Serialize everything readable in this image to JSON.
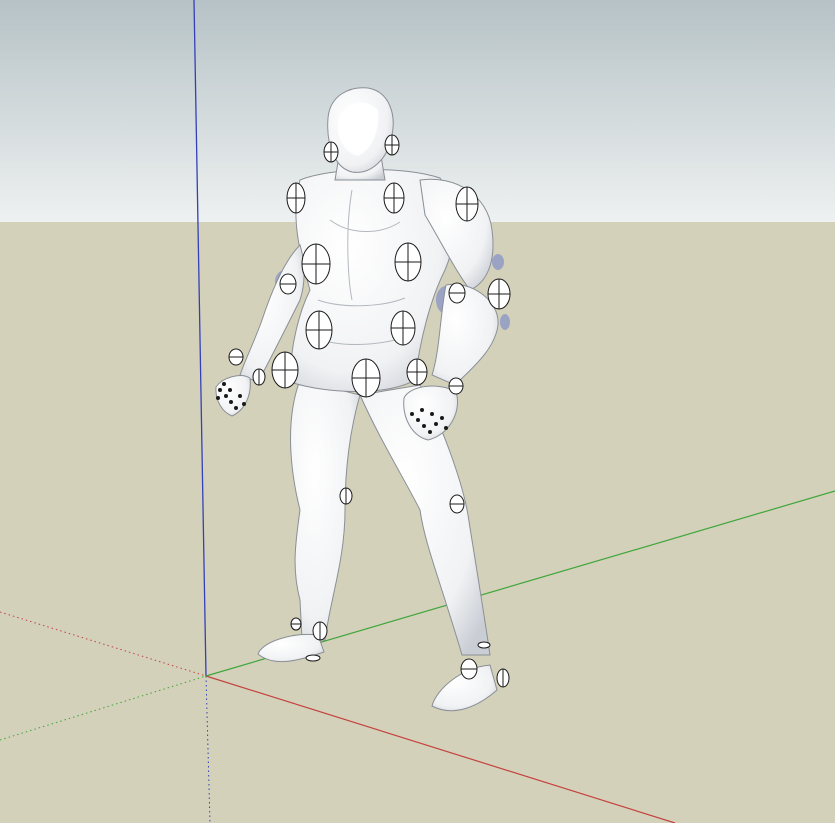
{
  "app": {
    "viewport": {
      "sky_top_color": "#b6c2c6",
      "sky_bottom_color": "#eef1f1",
      "ground_color": "#d4d1bb"
    },
    "axes": {
      "red_axis_color": "#c4423e",
      "green_axis_color": "#3fa63a",
      "blue_axis_color": "#3440b8",
      "dotted_axis_style": "dotted"
    },
    "model": {
      "name": "",
      "body_color": "#ffffff",
      "shade_color": "#c9cdd4",
      "outline_color": "#1a1a1a",
      "joint_marker_icon": "crosshair-circle-icon",
      "joint_shadow_color": "#9aa3c4"
    }
  }
}
